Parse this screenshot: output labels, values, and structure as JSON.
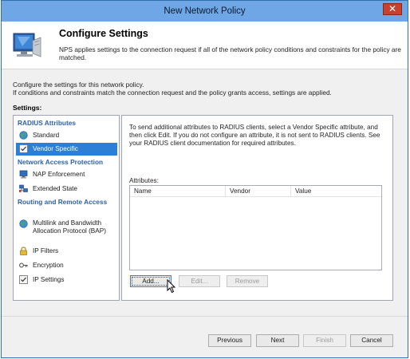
{
  "window": {
    "title": "New Network Policy",
    "close_label": "✕"
  },
  "header": {
    "title": "Configure Settings",
    "description": "NPS applies settings to the connection request if all of the network policy conditions and constraints for the policy are matched."
  },
  "intro": {
    "line1": "Configure the settings for this network policy.",
    "line2": "If conditions and constraints match the connection request and the policy grants access, settings are applied."
  },
  "settings_label": "Settings:",
  "nav": {
    "groups": [
      {
        "label": "RADIUS Attributes"
      },
      {
        "label": "Network Access Protection"
      },
      {
        "label": "Routing and Remote Access"
      }
    ],
    "items": [
      {
        "label": "Standard",
        "icon": "globe-icon"
      },
      {
        "label": "Vendor Specific",
        "icon": "checklist-icon",
        "selected": true
      },
      {
        "label": "NAP Enforcement",
        "icon": "computer-icon"
      },
      {
        "label": "Extended State",
        "icon": "network-icon"
      },
      {
        "label": "Multilink and Bandwidth Allocation Protocol (BAP)",
        "icon": "globe-icon"
      },
      {
        "label": "IP Filters",
        "icon": "lock-icon"
      },
      {
        "label": "Encryption",
        "icon": "key-icon"
      },
      {
        "label": "IP Settings",
        "icon": "checklist-icon"
      }
    ]
  },
  "content": {
    "description": "To send additional attributes to RADIUS clients, select a Vendor Specific attribute, and then click Edit. If you do not configure an attribute, it is not sent to RADIUS clients. See your RADIUS client documentation for required attributes.",
    "attributes_label": "Attributes:",
    "columns": [
      "Name",
      "Vendor",
      "Value"
    ],
    "buttons": {
      "add": "Add...",
      "edit": "Edit...",
      "remove": "Remove"
    }
  },
  "footer": {
    "previous": "Previous",
    "next": "Next",
    "finish": "Finish",
    "cancel": "Cancel"
  },
  "colors": {
    "titlebar": "#6fa7e6",
    "selected": "#2b7fd6",
    "group_text": "#2d62a8",
    "close": "#c7412e"
  }
}
